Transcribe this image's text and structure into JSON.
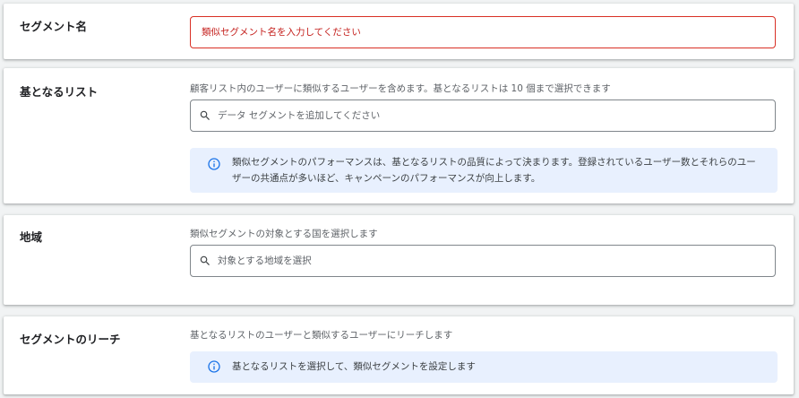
{
  "segment_name": {
    "title": "セグメント名",
    "placeholder": "類似セグメント名を入力してください"
  },
  "base_list": {
    "title": "基となるリスト",
    "description": "顧客リスト内のユーザーに類似するユーザーを含めます。基となるリストは 10 個まで選択できます",
    "search_placeholder": "データ セグメントを追加してください",
    "info_text": "類似セグメントのパフォーマンスは、基となるリストの品質によって決まります。登録されているユーザー数とそれらのユーザーの共通点が多いほど、キャンペーンのパフォーマンスが向上します。"
  },
  "region": {
    "title": "地域",
    "description": "類似セグメントの対象とする国を選択します",
    "search_placeholder": "対象とする地域を選択"
  },
  "segment_reach": {
    "title": "セグメントのリーチ",
    "description": "基となるリストのユーザーと類似するユーザーにリーチします",
    "info_text": "基となるリストを選択して、類似セグメントを設定します"
  },
  "colors": {
    "error": "#d93025",
    "info_background": "#e8f0fe",
    "info_icon": "#1a73e8"
  }
}
